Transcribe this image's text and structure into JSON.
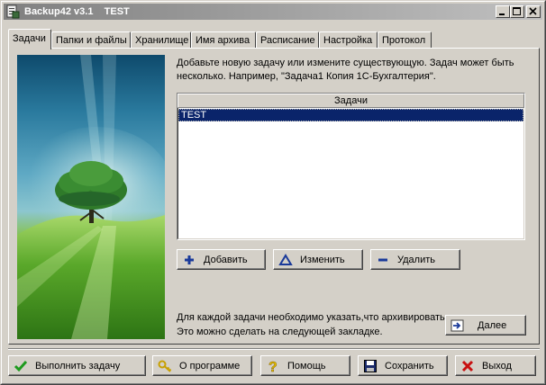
{
  "window": {
    "title": "Backup42 v3.1    TEST"
  },
  "tabs": [
    {
      "label": "Задачи"
    },
    {
      "label": "Папки и файлы"
    },
    {
      "label": "Хранилище"
    },
    {
      "label": "Имя архива"
    },
    {
      "label": "Расписание"
    },
    {
      "label": "Настройка"
    },
    {
      "label": "Протокол"
    }
  ],
  "tasks_tab": {
    "hint_line1": "Добавьте новую задачу или измените существующую. Задач может быть",
    "hint_line2": "несколько. Например, \"Задача1 Копия 1С-Бухгалтерия\".",
    "list_header": "Задачи",
    "tasks": [
      "TEST"
    ],
    "add_label": "Добавить",
    "edit_label": "Изменить",
    "delete_label": "Удалить",
    "footnote_line1": "Для каждой задачи необходимо указать,что архивировать.",
    "footnote_line2": "Это можно сделать на следующей закладке.",
    "next_label": "Далее"
  },
  "bottom": {
    "run_label": "Выполнить задачу",
    "about_label": "О программе",
    "help_label": "Помощь",
    "save_label": "Сохранить",
    "exit_label": "Выход"
  },
  "colors": {
    "selection": "#0a246a",
    "add_icon": "#1a3a9a",
    "run_icon": "#1e9a1e",
    "exit_icon": "#c81010"
  }
}
